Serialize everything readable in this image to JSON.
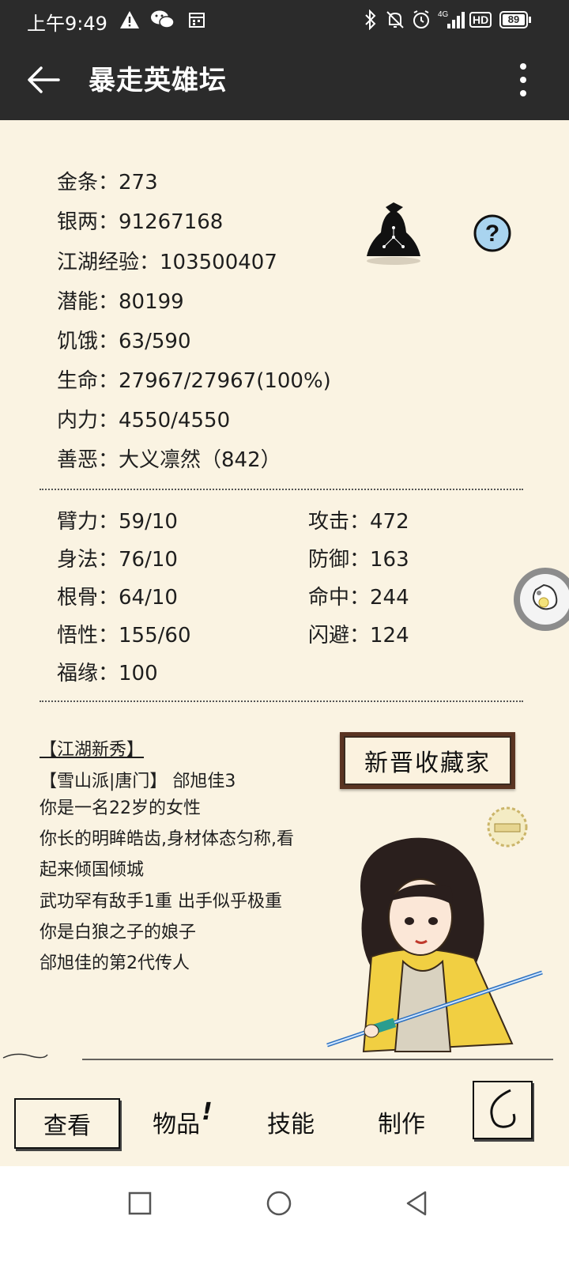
{
  "status_bar": {
    "time": "上午9:49",
    "battery": "89",
    "network": "4G",
    "hd": "HD"
  },
  "app_bar": {
    "title": "暴走英雄坛"
  },
  "basic_stats": [
    {
      "label": "金条：",
      "value": "273"
    },
    {
      "label": "银两：",
      "value": "91267168"
    },
    {
      "label": "江湖经验：",
      "value": "103500407"
    },
    {
      "label": "潜能：",
      "value": "80199"
    },
    {
      "label": "饥饿：",
      "value": "63/590"
    },
    {
      "label": "生命：",
      "value": "27967/27967(100%)"
    },
    {
      "label": "内力：",
      "value": "4550/4550"
    },
    {
      "label": "善恶：",
      "value": "大义凛然（842）"
    }
  ],
  "attr_left": [
    {
      "label": "臂力：",
      "value": "59/10"
    },
    {
      "label": "身法：",
      "value": "76/10"
    },
    {
      "label": "根骨：",
      "value": "64/10"
    },
    {
      "label": "悟性：",
      "value": "155/60"
    },
    {
      "label": "福缘：",
      "value": "100"
    }
  ],
  "attr_right": [
    {
      "label": "攻击：",
      "value": "472"
    },
    {
      "label": "防御：",
      "value": "163"
    },
    {
      "label": "命中：",
      "value": "244"
    },
    {
      "label": "闪避：",
      "value": "124"
    }
  ],
  "profile": {
    "rank": "【江湖新秀】",
    "title_badge": "新晋收藏家",
    "lines": [
      "【雪山派|唐门】 郃旭佳3",
      "你是一名22岁的女性",
      "你长的明眸皓齿,身材体态匀称,看",
      "起来倾国倾城",
      "武功罕有敌手1重 出手似乎极重",
      "你是白狼之子的娘子",
      "郃旭佳的第2代传人"
    ]
  },
  "bottom_nav": {
    "view": "查看",
    "items": "物品",
    "items_badge": "!",
    "skills": "技能",
    "craft": "制作"
  },
  "colors": {
    "bar_bg": "#2b2b2b",
    "paper": "#faf3e2",
    "text": "#1e1e1e",
    "help_icon_bg": "#a9d4ef"
  }
}
